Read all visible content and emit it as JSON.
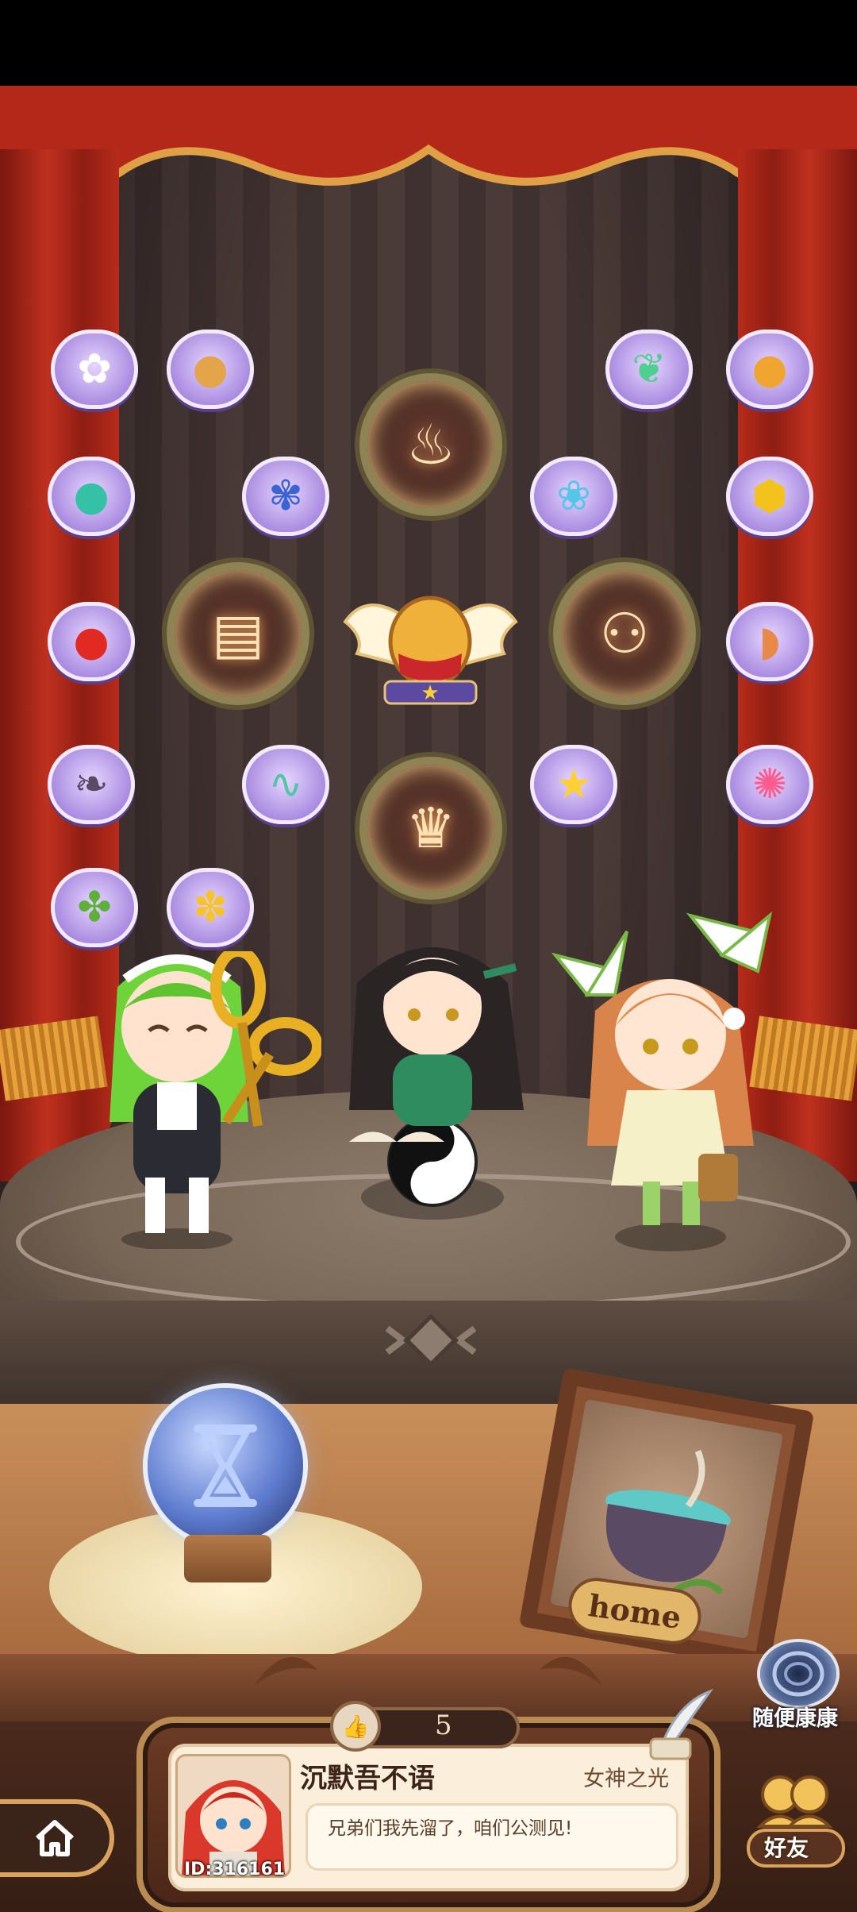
{
  "stage": {
    "items": [
      {
        "name": "daisy-flower-icon",
        "glyph": "✿",
        "color": "#ffffff"
      },
      {
        "name": "walnut-icon",
        "glyph": "●",
        "color": "#e3a44a"
      },
      {
        "name": "leaf-icon",
        "glyph": "❦",
        "color": "#4fd08f"
      },
      {
        "name": "fruit-icon",
        "glyph": "●",
        "color": "#f0a530"
      },
      {
        "name": "green-fruit-icon",
        "glyph": "●",
        "color": "#35c1a6"
      },
      {
        "name": "pinwheel-flower-icon",
        "glyph": "✾",
        "color": "#3c63d6"
      },
      {
        "name": "butterfly-icon",
        "glyph": "❀",
        "color": "#55c6e8"
      },
      {
        "name": "honeycomb-icon",
        "glyph": "⬢",
        "color": "#f4c21c"
      },
      {
        "name": "tomato-icon",
        "glyph": "●",
        "color": "#e02a22"
      },
      {
        "name": "seashell-icon",
        "glyph": "◗",
        "color": "#e8894a"
      },
      {
        "name": "dark-leaves-icon",
        "glyph": "❧",
        "color": "#5a4a66"
      },
      {
        "name": "feather-icon",
        "glyph": "∿",
        "color": "#4fc6a5"
      },
      {
        "name": "star-icon",
        "glyph": "★",
        "color": "#ffd033"
      },
      {
        "name": "coral-icon",
        "glyph": "✺",
        "color": "#ff5b8e"
      },
      {
        "name": "herb-icon",
        "glyph": "✤",
        "color": "#5db03a"
      },
      {
        "name": "yellow-flower-icon",
        "glyph": "✽",
        "color": "#f7c32b"
      }
    ],
    "emblems": [
      {
        "name": "cauldron-emblem-icon",
        "glyph": "♨"
      },
      {
        "name": "book-emblem-icon",
        "glyph": "▤"
      },
      {
        "name": "dancers-emblem-icon",
        "glyph": "⚇"
      },
      {
        "name": "trophy-emblem-icon",
        "glyph": "♛"
      }
    ],
    "frame_label": "home"
  },
  "player": {
    "name": "沉默吾不语",
    "title": "女神之光",
    "message": "兄弟们我先溜了，咱们公测见!",
    "id": "ID:316161",
    "likes": "5"
  },
  "buttons": {
    "random_visit": "随便康康",
    "friends": "好友"
  }
}
